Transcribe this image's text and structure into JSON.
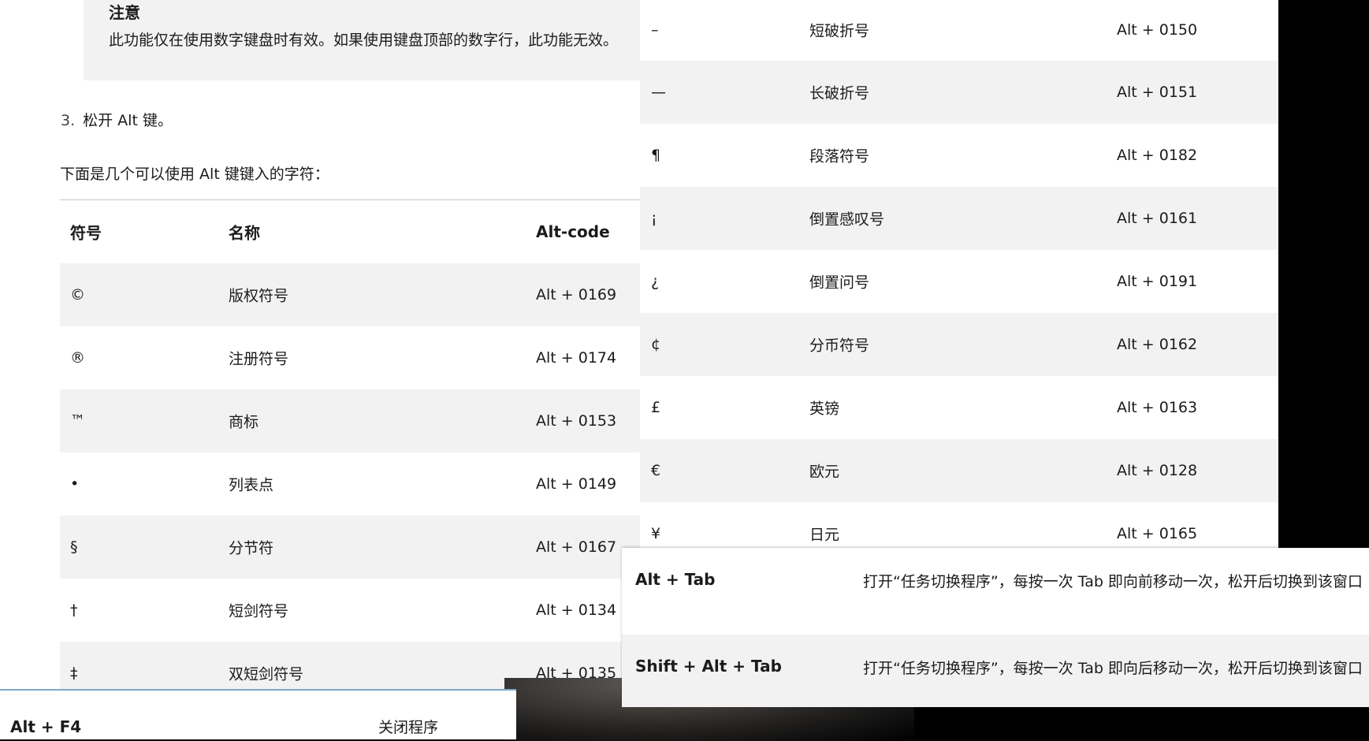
{
  "doc": {
    "note_title": "注意",
    "note_text": "此功能仅在使用数字键盘时有效。如果使用键盘顶部的数字行，此功能无效。",
    "step_number": "3.",
    "step_text": "松开 Alt 键。",
    "intro": "下面是几个可以使用 Alt 键键入的字符：",
    "table": {
      "headers": [
        "符号",
        "名称",
        "Alt-code"
      ],
      "rows": [
        {
          "symbol": "©",
          "name": "版权符号",
          "code": "Alt + 0169"
        },
        {
          "symbol": "®",
          "name": "注册符号",
          "code": "Alt + 0174"
        },
        {
          "symbol": "™",
          "name": "商标",
          "code": "Alt + 0153"
        },
        {
          "symbol": "•",
          "name": "列表点",
          "code": "Alt + 0149"
        },
        {
          "symbol": "§",
          "name": "分节符",
          "code": "Alt + 0167"
        },
        {
          "symbol": "†",
          "name": "短剑符号",
          "code": "Alt + 0134"
        },
        {
          "symbol": "‡",
          "name": "双短剑符号",
          "code": "Alt + 0135"
        }
      ]
    }
  },
  "right_table": {
    "rows": [
      {
        "symbol": "–",
        "name": "短破折号",
        "code": "Alt + 0150"
      },
      {
        "symbol": "—",
        "name": "长破折号",
        "code": "Alt + 0151"
      },
      {
        "symbol": "¶",
        "name": "段落符号",
        "code": "Alt + 0182"
      },
      {
        "symbol": "¡",
        "name": "倒置感叹号",
        "code": "Alt + 0161"
      },
      {
        "symbol": "¿",
        "name": "倒置问号",
        "code": "Alt + 0191"
      },
      {
        "symbol": "¢",
        "name": "分币符号",
        "code": "Alt + 0162"
      },
      {
        "symbol": "£",
        "name": "英镑",
        "code": "Alt + 0163"
      },
      {
        "symbol": "€",
        "name": "欧元",
        "code": "Alt + 0128"
      },
      {
        "symbol": "¥",
        "name": "日元",
        "code": "Alt + 0165"
      }
    ]
  },
  "shortcuts_right": [
    {
      "keys": "Alt + Tab",
      "desc": "打开“任务切换程序”，每按一次 Tab 即向前移动一次，松开后切换到该窗口"
    },
    {
      "keys": "Shift + Alt + Tab",
      "desc": "打开“任务切换程序”，每按一次 Tab 即向后移动一次，松开后切换到该窗口"
    }
  ],
  "shortcuts_left": [
    {
      "keys": "Alt + F4",
      "desc": "关闭程序"
    }
  ],
  "colors": {
    "row_shade": "#f2f2f2",
    "panel_bg": "#ffffff",
    "desktop_bg": "#000000",
    "panel_edge": "#7fa7c8"
  }
}
